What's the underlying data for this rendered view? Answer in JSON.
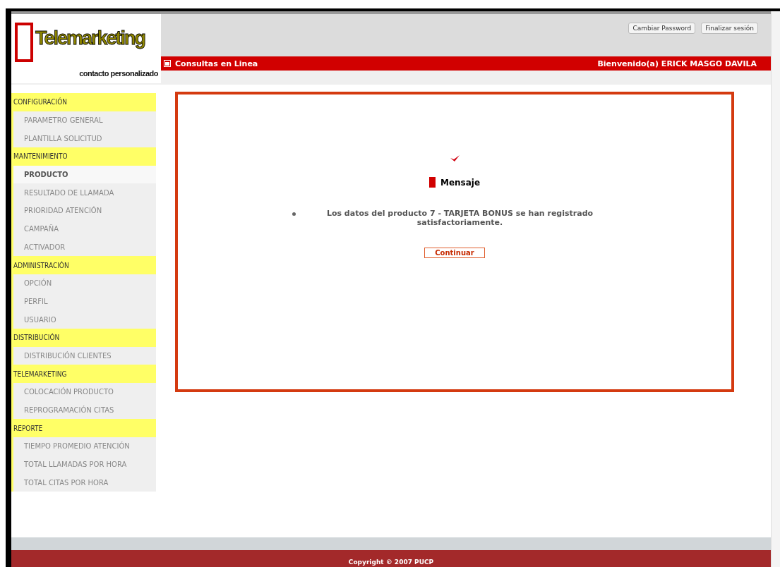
{
  "logo": {
    "title": "Telemarketing",
    "tagline": "contacto personalizado"
  },
  "header_buttons": [
    "Cambiar Password",
    "Finalizar sesión"
  ],
  "bar": {
    "title": "Consultas en Linea",
    "welcome": "Bienvenido(a)  ERICK MASGO DAVILA"
  },
  "sidebar": [
    {
      "label": "CONFIGURACIÓN",
      "items": [
        {
          "label": "PARAMETRO GENERAL",
          "selected": false
        },
        {
          "label": "PLANTILLA SOLICITUD",
          "selected": false
        }
      ]
    },
    {
      "label": "MANTENIMIENTO",
      "items": [
        {
          "label": "PRODUCTO",
          "selected": true
        },
        {
          "label": "RESULTADO DE LLAMADA",
          "selected": false
        },
        {
          "label": "PRIORIDAD ATENCIÓN",
          "selected": false
        },
        {
          "label": "CAMPAÑA",
          "selected": false
        },
        {
          "label": "ACTIVADOR",
          "selected": false
        }
      ]
    },
    {
      "label": "ADMINISTRACIÓN",
      "items": [
        {
          "label": "OPCIÓN",
          "selected": false
        },
        {
          "label": "PERFIL",
          "selected": false
        },
        {
          "label": "USUARIO",
          "selected": false
        }
      ]
    },
    {
      "label": "DISTRIBUCIÓN",
      "items": [
        {
          "label": "DISTRIBUCIÓN CLIENTES",
          "selected": false
        }
      ]
    },
    {
      "label": "TELEMARKETING",
      "items": [
        {
          "label": "COLOCACIÓN PRODUCTO",
          "selected": false
        },
        {
          "label": "REPROGRAMACIÓN CITAS",
          "selected": false
        }
      ]
    },
    {
      "label": "REPORTE",
      "items": [
        {
          "label": "TIEMPO PROMEDIO ATENCIÓN",
          "selected": false
        },
        {
          "label": "TOTAL LLAMADAS POR HORA",
          "selected": false
        },
        {
          "label": "TOTAL CITAS POR HORA",
          "selected": false
        }
      ]
    }
  ],
  "message": {
    "title": "Mensaje",
    "lines": [
      "Los datos del producto 7 - TARJETA BONUS se han registrado satisfactoriamente."
    ],
    "button": "Continuar"
  },
  "footer": "Copyright © 2007 PUCP"
}
